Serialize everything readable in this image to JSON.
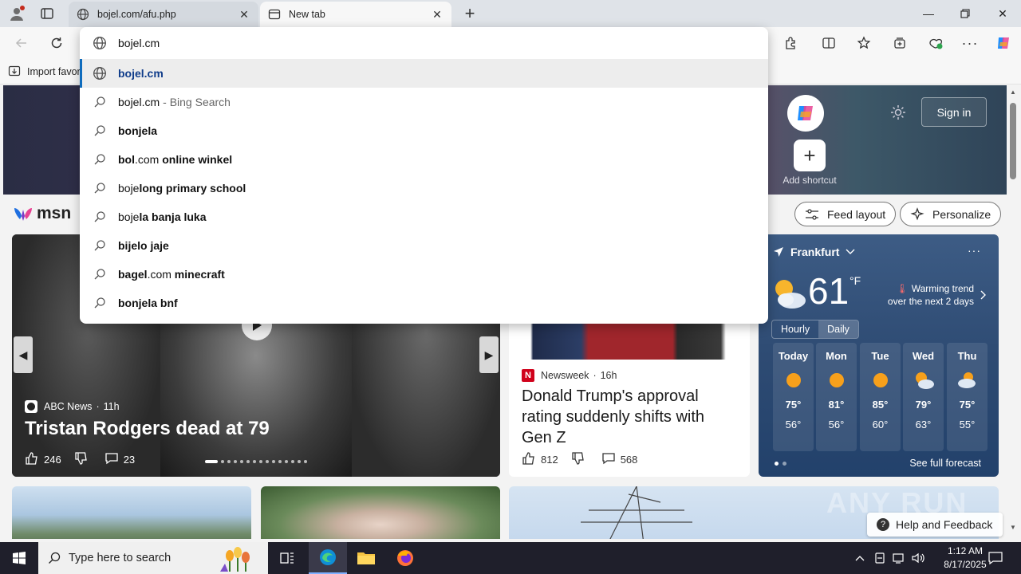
{
  "tabs": [
    {
      "title": "bojel.com/afu.php",
      "active": false
    },
    {
      "title": "New tab",
      "active": true
    }
  ],
  "favorites_bar": {
    "import_label": "Import favor"
  },
  "omnibox": {
    "value": "bojel.cm",
    "suggestions": [
      {
        "bold": "bojel.cm",
        "normal_after": "",
        "sub": "",
        "icon": "globe-icon",
        "selected": true
      },
      {
        "normal": "bojel.cm",
        "sub": "- Bing Search",
        "icon": "search-icon"
      },
      {
        "bold": "bonjela",
        "icon": "search-icon"
      },
      {
        "bold": "bol",
        "normal": ".com",
        "bold2": " online winkel",
        "icon": "search-icon"
      },
      {
        "normal": "boje",
        "bold": "long primary school",
        "icon": "search-icon"
      },
      {
        "normal": "boje",
        "bold": "la banja luka",
        "icon": "search-icon"
      },
      {
        "bold": "bijelo jaje",
        "icon": "search-icon"
      },
      {
        "bold": "bagel",
        "normal": ".com",
        "bold2": " minecraft",
        "icon": "search-icon"
      },
      {
        "bold": "bonjela bnf",
        "icon": "search-icon"
      }
    ]
  },
  "hero": {
    "signin_label": "Sign in",
    "add_shortcut_label": "Add shortcut"
  },
  "msn": {
    "logo_text": "msn",
    "feed_layout_label": "Feed layout",
    "personalize_label": "Personalize"
  },
  "main_card": {
    "source": "ABC News",
    "age": "11h",
    "headline": "Tristan Rodgers dead at 79",
    "likes": "246",
    "comments": "23"
  },
  "news_card": {
    "source": "Newsweek",
    "age": "16h",
    "headline": "Donald Trump's approval rating suddenly shifts with Gen Z",
    "likes": "812",
    "comments": "568"
  },
  "weather": {
    "location": "Frankfurt",
    "temp": "61",
    "unit": "°F",
    "trend_line1": "Warming trend",
    "trend_line2": "over the next 2 days",
    "hourly_label": "Hourly",
    "daily_label": "Daily",
    "days": [
      {
        "day": "Today",
        "hi": "75°",
        "lo": "56°",
        "icon": "sun-icon"
      },
      {
        "day": "Mon",
        "hi": "81°",
        "lo": "56°",
        "icon": "sun-icon"
      },
      {
        "day": "Tue",
        "hi": "85°",
        "lo": "60°",
        "icon": "sun-icon"
      },
      {
        "day": "Wed",
        "hi": "79°",
        "lo": "63°",
        "icon": "partly-cloudy-icon"
      },
      {
        "day": "Thu",
        "hi": "75°",
        "lo": "55°",
        "icon": "partly-cloudy-icon"
      }
    ],
    "see_forecast": "See full forecast"
  },
  "help_label": "Help and Feedback",
  "watermark": "ANY RUN",
  "taskbar": {
    "search_placeholder": "Type here to search",
    "time": "1:12 AM",
    "date": "8/17/2025"
  },
  "colors": {
    "accent": "#0f6cbd",
    "taskbar": "#1f1f2b",
    "weather_bg": "#2e4b73"
  }
}
